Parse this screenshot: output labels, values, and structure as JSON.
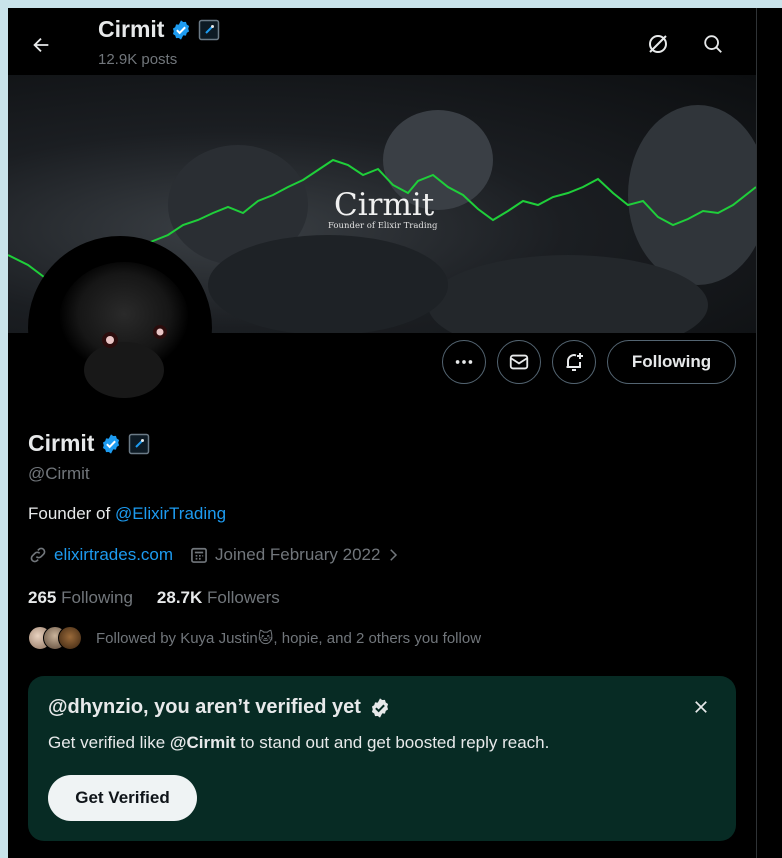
{
  "header": {
    "name": "Cirmit",
    "posts": "12.9K posts"
  },
  "banner": {
    "title": "Cirmit",
    "subtitle": "Founder of Elixir Trading"
  },
  "actions": {
    "following_label": "Following"
  },
  "profile": {
    "display_name": "Cirmit",
    "handle": "@Cirmit",
    "bio_prefix": "Founder of ",
    "bio_link": "@ElixirTrading",
    "website": "elixirtrades.com",
    "joined": "Joined February 2022",
    "following_count": "265",
    "following_label": "Following",
    "followers_count": "28.7K",
    "followers_label": "Followers",
    "followed_by_prefix": "Followed by Kuya Justin ",
    "followed_by_emoji": "🐱",
    "followed_by_suffix": ", hopie, and 2 others you follow"
  },
  "verify_card": {
    "title": "@dhynzio, you aren’t verified yet",
    "text_prefix": "Get verified like ",
    "text_handle": "@Cirmit",
    "text_suffix": " to stand out and get boosted reply reach.",
    "button": "Get Verified"
  },
  "colors": {
    "background": "#000000",
    "accent": "#1d9bf0",
    "muted": "#71767b",
    "card": "#072b24",
    "chart_green": "#22c55e"
  },
  "icons": [
    "back-arrow-icon",
    "grok-icon",
    "search-icon",
    "more-icon",
    "message-icon",
    "notification-bell-icon",
    "verified-badge-icon",
    "affiliate-badge-icon",
    "link-icon",
    "calendar-icon",
    "chevron-right-icon",
    "close-icon"
  ]
}
